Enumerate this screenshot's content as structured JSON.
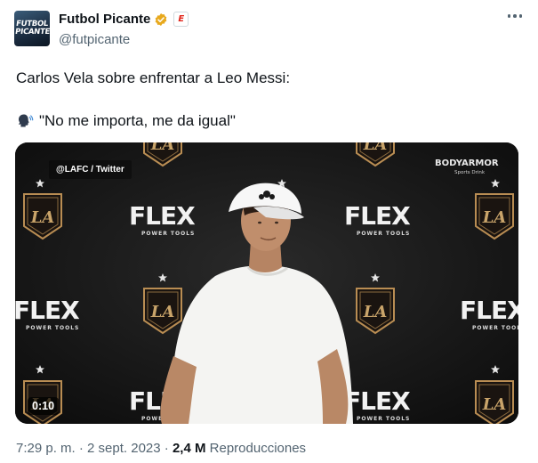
{
  "author": {
    "name": "Futbol Picante",
    "handle": "@futpicante",
    "avatar_line1": "FUTBOL",
    "avatar_line2": "PICANTE",
    "affiliate_badge": "E",
    "verified_color": "#e8a91d"
  },
  "tweet": {
    "text": "Carlos Vela sobre enfrentar a Leo Messi:",
    "quote": "\"No me importa, me da igual\"",
    "quote_icon": "speaking-head-icon"
  },
  "media": {
    "credit": "@LAFC / Twitter",
    "duration": "0:10",
    "sponsor_main": "FLEX",
    "sponsor_sub": "POWER TOOLS",
    "sponsor2": "BODYARMOR",
    "sponsor2_sub": "Sports Drink",
    "crest_text": "LA"
  },
  "meta": {
    "time": "7:29 p. m.",
    "separator": "·",
    "date": "2 sept. 2023",
    "views_count": "2,4 M",
    "views_label": "Reproducciones"
  }
}
